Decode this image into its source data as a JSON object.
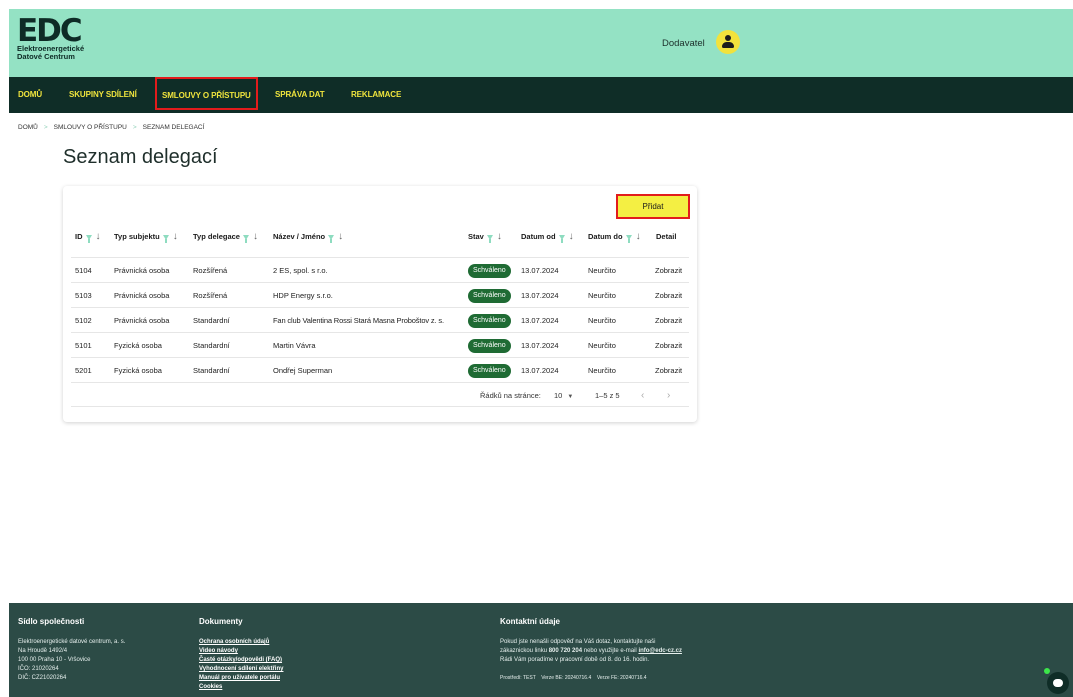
{
  "header": {
    "logo_mark": "EDC",
    "logo_line1": "Elektroenergetické",
    "logo_line2": "Datové Centrum",
    "user_role": "Dodavatel"
  },
  "nav": {
    "items": [
      "DOMŮ",
      "SKUPINY SDÍLENÍ",
      "SMLOUVY O PŘÍSTUPU",
      "SPRÁVA DAT",
      "REKLAMACE"
    ],
    "active_index": 2
  },
  "breadcrumb": [
    "DOMŮ",
    "SMLOUVY O PŘÍSTUPU",
    "SEZNAM DELEGACÍ"
  ],
  "page_title": "Seznam delegací",
  "add_button": "Přidat",
  "table": {
    "columns": [
      "ID",
      "Typ subjektu",
      "Typ delegace",
      "Název / Jméno",
      "Stav",
      "Datum od",
      "Datum do",
      "Detail"
    ],
    "rows": [
      {
        "id": "5104",
        "subject_type": "Právnická osoba",
        "delegation_type": "Rozšířená",
        "name": "2 ES, spol. s r.o.",
        "status": "Schváleno",
        "date_from": "13.07.2024",
        "date_to": "Neurčito",
        "detail": "Zobrazit"
      },
      {
        "id": "5103",
        "subject_type": "Právnická osoba",
        "delegation_type": "Rozšířená",
        "name": "HDP Energy s.r.o.",
        "status": "Schváleno",
        "date_from": "13.07.2024",
        "date_to": "Neurčito",
        "detail": "Zobrazit"
      },
      {
        "id": "5102",
        "subject_type": "Právnická osoba",
        "delegation_type": "Standardní",
        "name": "Fan club Valentina Rossi Stará Masna Proboštov z. s.",
        "status": "Schváleno",
        "date_from": "13.07.2024",
        "date_to": "Neurčito",
        "detail": "Zobrazit"
      },
      {
        "id": "5101",
        "subject_type": "Fyzická osoba",
        "delegation_type": "Standardní",
        "name": "Martin Vávra",
        "status": "Schváleno",
        "date_from": "13.07.2024",
        "date_to": "Neurčito",
        "detail": "Zobrazit"
      },
      {
        "id": "5201",
        "subject_type": "Fyzická osoba",
        "delegation_type": "Standardní",
        "name": "Ondřej Superman",
        "status": "Schváleno",
        "date_from": "13.07.2024",
        "date_to": "Neurčito",
        "detail": "Zobrazit"
      }
    ],
    "pagination": {
      "rows_label": "Řádků na stránce:",
      "rows_per_page": "10",
      "range": "1–5 z 5"
    }
  },
  "footer": {
    "col1": {
      "heading": "Sídlo společnosti",
      "lines": [
        "Elektroenergetické datové centrum, a. s.",
        "Na Hroudě 1492/4",
        "100 00 Praha 10 - Vršovice",
        "IČO: 21020264",
        "DIČ: CZ21020264"
      ]
    },
    "col2": {
      "heading": "Dokumenty",
      "links": [
        "Ochrana osobních údajů",
        "Video návody",
        "Časté otázky/odpovědi (FAQ)",
        "Vyhodnocení sdílení elektřiny",
        "Manuál pro uživatele portálu",
        "Cookies"
      ]
    },
    "col3": {
      "heading": "Kontaktní údaje",
      "line1": "Pokud jste nenašli odpověď na Váš dotaz, kontaktujte naši",
      "line2_pre": "zákaznickou linku ",
      "phone": "800 720 204",
      "line2_mid": " nebo využijte e-mail ",
      "email": "info@edc-cz.cz",
      "line3": "Rádi Vám poradíme v pracovní době od 8. do 16. hodin.",
      "versions": "Prostředí: TEST    Verze BE: 20240716.4    Verze FE: 20240716.4"
    }
  },
  "colors": {
    "header_bg": "#94e2c4",
    "nav_bg": "#0f2d27",
    "nav_text": "#f0e53d",
    "badge_bg": "#1f6b34",
    "footer_bg": "#2c4b46",
    "highlight_border": "#e21c1c",
    "add_button_bg": "#f4ef43"
  },
  "icons": {
    "avatar": "user-avatar-icon",
    "filter": "filter-icon",
    "sort": "sort-down-arrow-icon",
    "chat": "chat-bubble-icon"
  }
}
